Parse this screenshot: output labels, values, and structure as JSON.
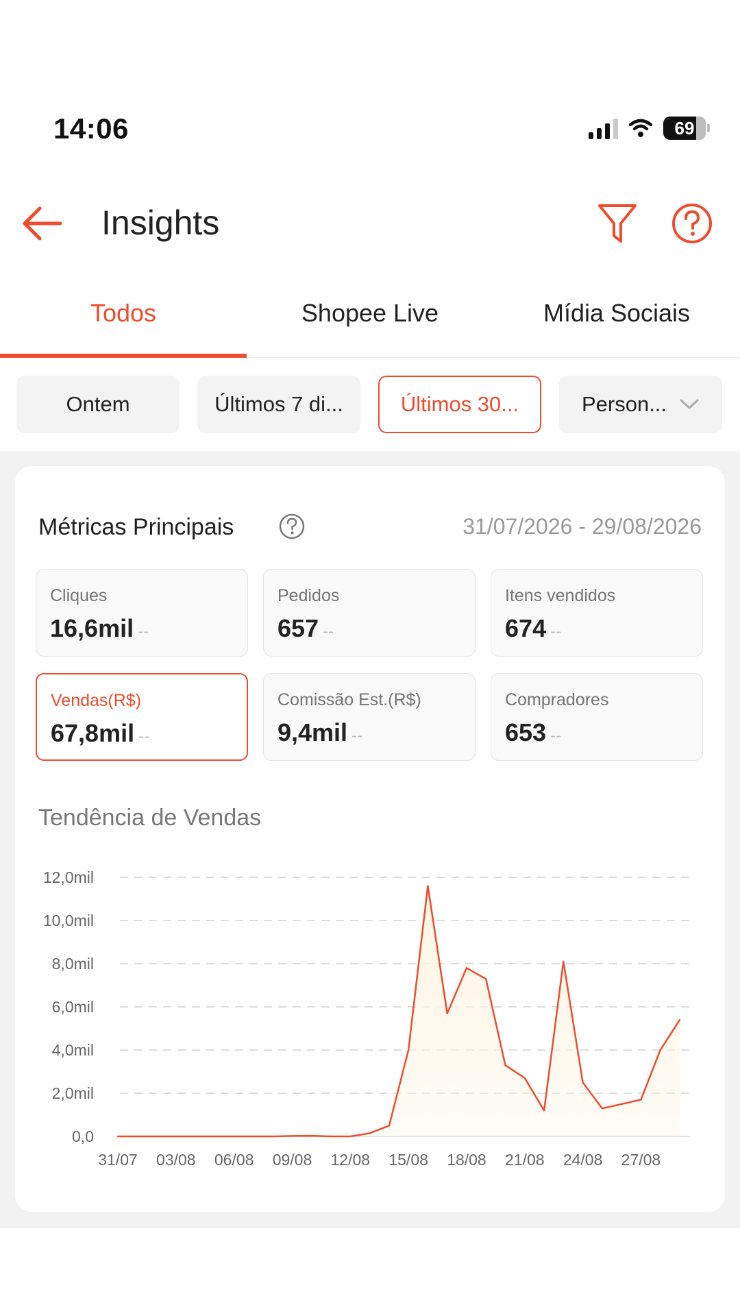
{
  "status_bar": {
    "time": "14:06",
    "battery": "69"
  },
  "header": {
    "title": "Insights"
  },
  "tabs": [
    {
      "label": "Todos",
      "active": true
    },
    {
      "label": "Shopee Live",
      "active": false
    },
    {
      "label": "Mídia Sociais",
      "active": false
    }
  ],
  "chips": [
    {
      "label": "Ontem",
      "active": false
    },
    {
      "label": "Últimos 7 di...",
      "active": false
    },
    {
      "label": "Últimos 30...",
      "active": true
    },
    {
      "label": "Person...",
      "active": false
    }
  ],
  "metrics": {
    "title": "Métricas Principais",
    "date_range": "31/07/2026 - 29/08/2026",
    "items": [
      {
        "label": "Cliques",
        "value": "16,6mil",
        "delta": "--"
      },
      {
        "label": "Pedidos",
        "value": "657",
        "delta": "--"
      },
      {
        "label": "Itens vendidos",
        "value": "674",
        "delta": "--"
      },
      {
        "label": "Vendas(R$)",
        "value": "67,8mil",
        "delta": "--"
      },
      {
        "label": "Comissão Est.(R$)",
        "value": "9,4mil",
        "delta": "--"
      },
      {
        "label": "Compradores",
        "value": "653",
        "delta": "--"
      }
    ]
  },
  "chart_title": "Tendência de Vendas",
  "colors": {
    "accent": "#ee4d2d",
    "fill": "#fdf6e3"
  },
  "chart_data": {
    "type": "area",
    "x_tick_labels": [
      "31/07",
      "03/08",
      "06/08",
      "09/08",
      "12/08",
      "15/08",
      "18/08",
      "21/08",
      "24/08",
      "27/08"
    ],
    "y_tick_labels": [
      "0,0",
      "2,0mil",
      "4,0mil",
      "6,0mil",
      "8,0mil",
      "10,0mil",
      "12,0mil"
    ],
    "ylim": [
      0,
      12000
    ],
    "grid": true,
    "x": [
      "31/07",
      "01/08",
      "02/08",
      "03/08",
      "04/08",
      "05/08",
      "06/08",
      "07/08",
      "08/08",
      "09/08",
      "10/08",
      "11/08",
      "12/08",
      "13/08",
      "14/08",
      "15/08",
      "16/08",
      "17/08",
      "18/08",
      "19/08",
      "20/08",
      "21/08",
      "22/08",
      "23/08",
      "24/08",
      "25/08",
      "26/08",
      "27/08",
      "28/08",
      "29/08"
    ],
    "values": [
      0,
      0,
      0,
      0,
      0,
      0,
      0,
      0,
      0,
      20,
      30,
      0,
      0,
      150,
      500,
      4000,
      11600,
      5700,
      7800,
      7300,
      3300,
      2700,
      1200,
      8100,
      2500,
      1300,
      1500,
      1700,
      4000,
      5400
    ]
  }
}
